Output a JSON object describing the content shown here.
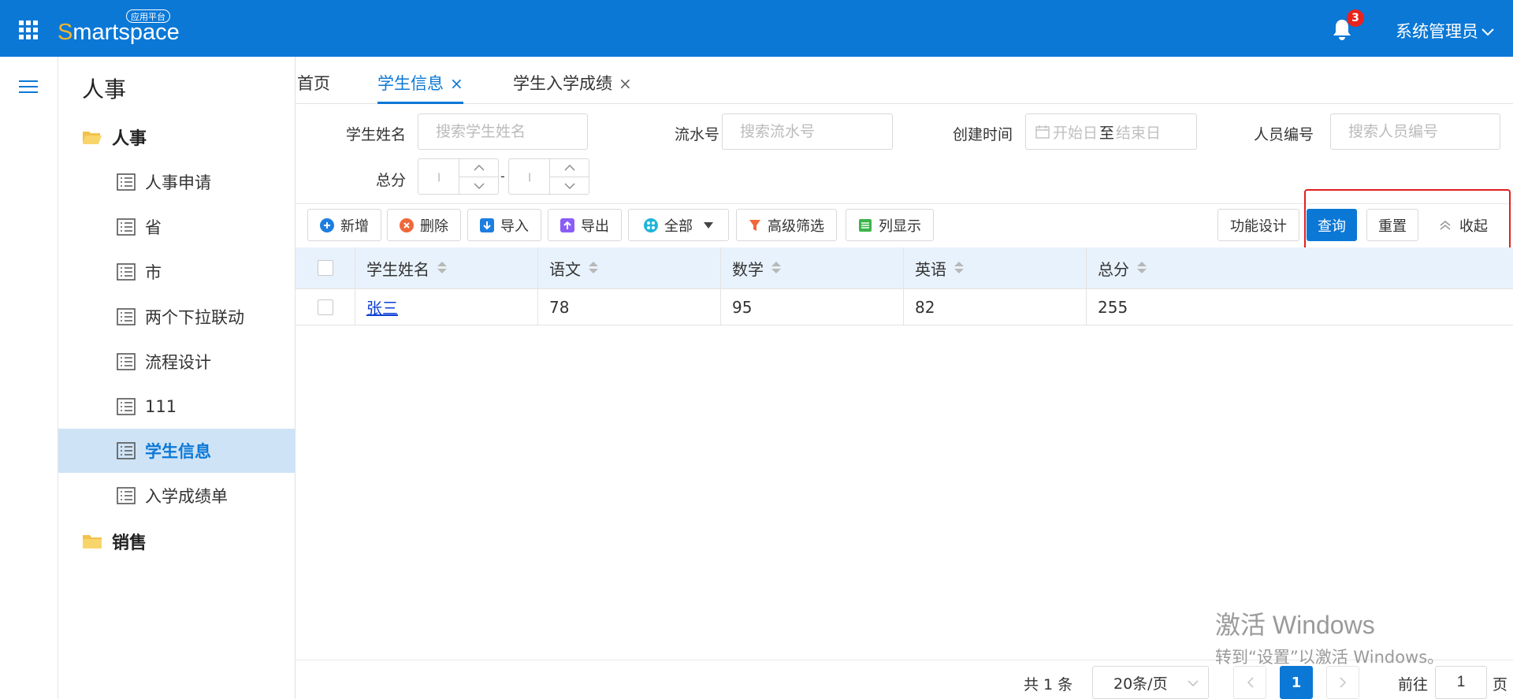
{
  "app": {
    "logo_s": "S",
    "logo_rest": "martspace",
    "logo_badge": "应用平台",
    "notification_count": "3",
    "user_name": "系统管理员"
  },
  "colors": {
    "primary": "#0b78d6",
    "highlight_border": "#e02020",
    "badge": "#e8231d"
  },
  "sidebar": {
    "title": "人事",
    "groups": [
      {
        "label": "人事",
        "icon": "folder-open-icon"
      },
      {
        "label": "销售",
        "icon": "folder-icon"
      }
    ],
    "items": [
      {
        "label": "人事申请"
      },
      {
        "label": "省"
      },
      {
        "label": "市"
      },
      {
        "label": "两个下拉联动"
      },
      {
        "label": "流程设计"
      },
      {
        "label": "111"
      },
      {
        "label": "学生信息",
        "active": true
      },
      {
        "label": "入学成绩单"
      }
    ]
  },
  "tabs": [
    {
      "label": "首页"
    },
    {
      "label": "学生信息",
      "active": true
    },
    {
      "label": "学生入学成绩"
    }
  ],
  "tab_close": "×",
  "filters": {
    "name_label": "学生姓名",
    "name_placeholder": "搜索学生姓名",
    "serial_label": "流水号",
    "serial_placeholder": "搜索流水号",
    "created_label": "创建时间",
    "created_start": "开始日",
    "created_to": "至",
    "created_end": "结束日",
    "staff_label": "人员编号",
    "staff_placeholder": "搜索人员编号",
    "total_label": "总分",
    "range_dash": "-"
  },
  "toolbar": {
    "add": "新增",
    "delete": "删除",
    "import": "导入",
    "export": "导出",
    "all": "全部",
    "advanced_filter": "高级筛选",
    "column_display": "列显示",
    "function_design": "功能设计",
    "query": "查询",
    "reset": "重置",
    "collapse": "收起"
  },
  "table": {
    "columns": [
      "学生姓名",
      "语文",
      "数学",
      "英语",
      "总分"
    ],
    "rows": [
      {
        "name": "张三",
        "chinese": "78",
        "math": "95",
        "english": "82",
        "total": "255"
      }
    ]
  },
  "pagination": {
    "total_text": "共 1 条",
    "page_size": "20条/页",
    "current": "1",
    "goto_label": "前往",
    "goto_value": "1",
    "page_unit": "页"
  },
  "watermark": {
    "line1": "激活 Windows",
    "line2": "转到“设置”以激活 Windows。"
  }
}
